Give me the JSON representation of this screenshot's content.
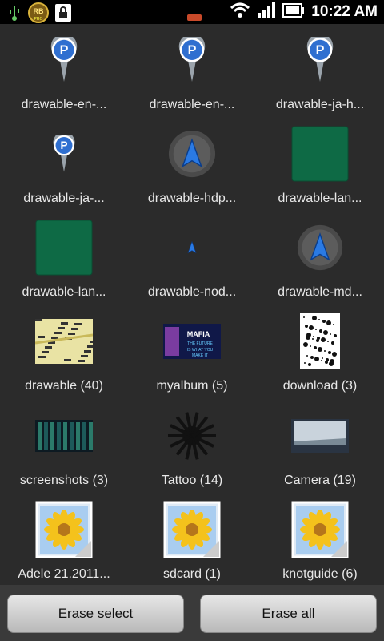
{
  "status_bar": {
    "time": "10:22 AM",
    "icons": [
      "usb-icon",
      "rb-pro-icon",
      "lock-icon",
      "notification-icon",
      "wifi-icon",
      "signal-icon",
      "battery-icon"
    ],
    "notification_badge": "PRO"
  },
  "grid": {
    "rows": [
      [
        "drawable-en-...",
        "drawable-en-...",
        "drawable-ja-h..."
      ],
      [
        "drawable-ja-...",
        "drawable-hdp...",
        "drawable-lan..."
      ],
      [
        "drawable-lan...",
        "drawable-nod...",
        "drawable-md..."
      ],
      [
        "drawable (40)",
        "myalbum (5)",
        "download (3)"
      ],
      [
        "screenshots (3)",
        "Tattoo (14)",
        "Camera (19)"
      ],
      [
        "Adele 21.2011...",
        "sdcard (1)",
        "knotguide (6)"
      ]
    ],
    "thumb_types": [
      [
        "pin",
        "pin",
        "pin"
      ],
      [
        "pin-small",
        "nav-arrow",
        "green-square"
      ],
      [
        "green-square",
        "nav-arrow-small",
        "nav-arrow-glow"
      ],
      [
        "map-photo",
        "album-photo",
        "doc-photo"
      ],
      [
        "screen-photo",
        "tattoo-photo",
        "camera-photo"
      ],
      [
        "sunflower",
        "sunflower",
        "sunflower"
      ]
    ],
    "pin_letter": "P",
    "album_text": "MAFIA THE FUTURE IS WHAT YOU MAKE IT"
  },
  "buttons": {
    "erase_select": "Erase select",
    "erase_all": "Erase all"
  }
}
